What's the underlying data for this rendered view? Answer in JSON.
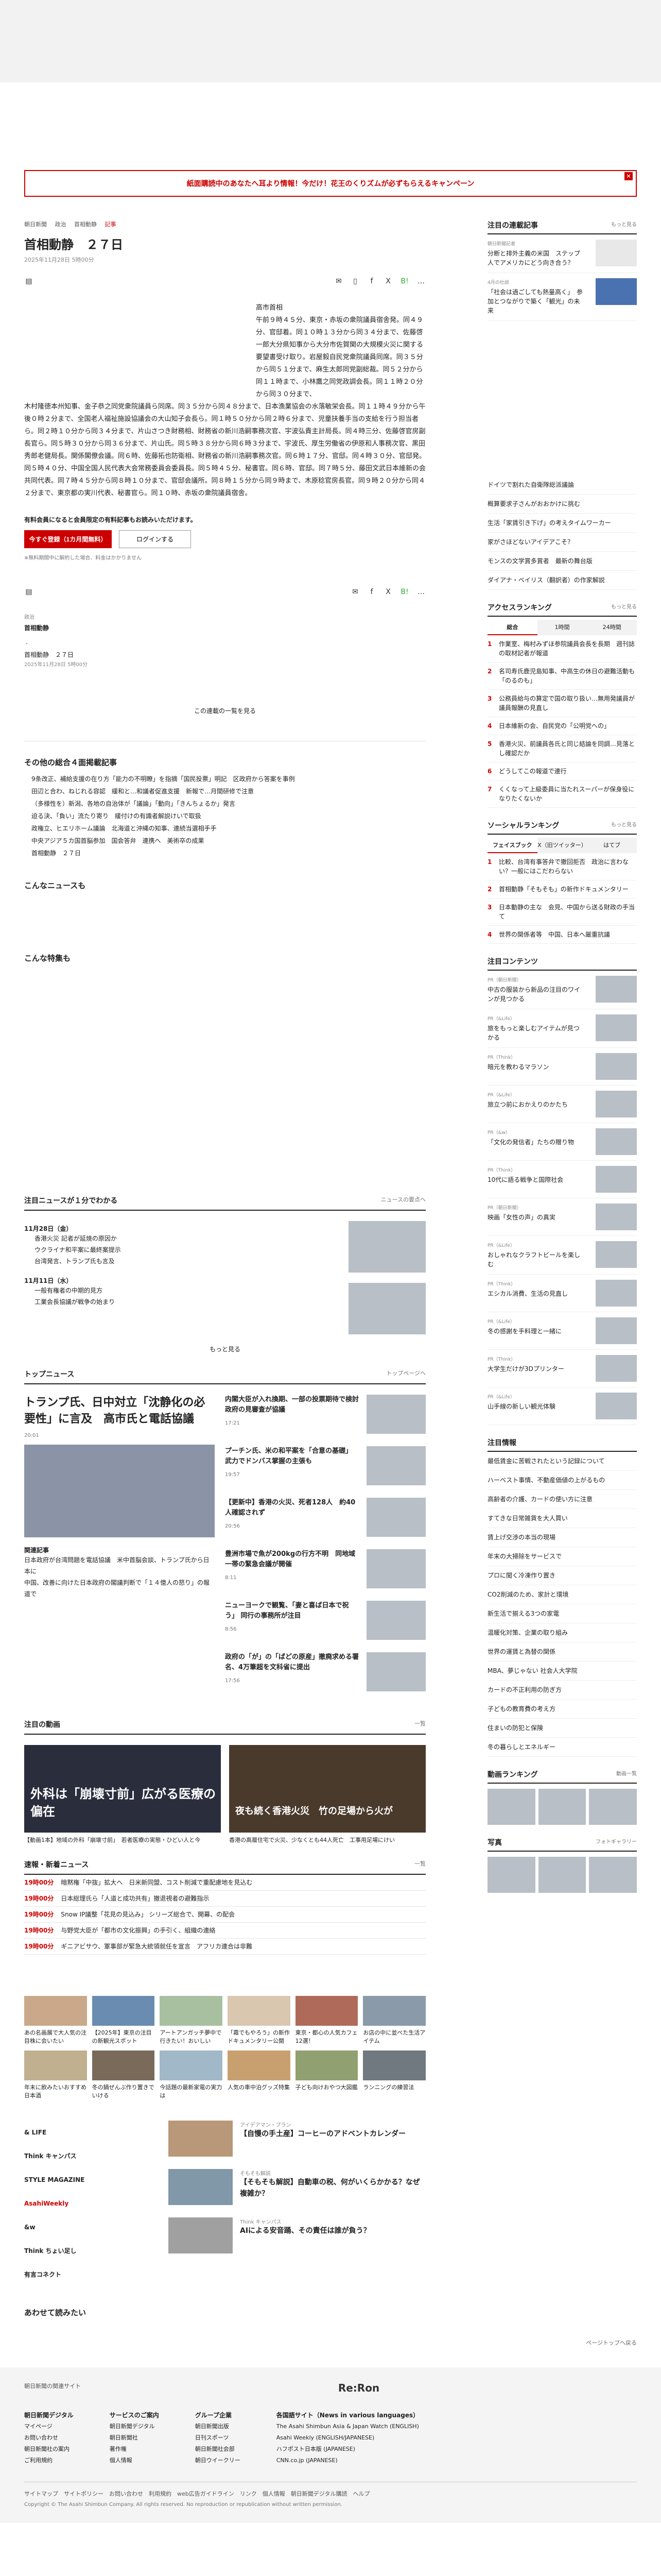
{
  "campaign": {
    "text": "紙面購読中のあなたへ耳より情報！今だけ！花王のくりズムが必ずもらえるキャンペーン",
    "close": "×"
  },
  "article": {
    "crumbs": [
      "朝日新聞",
      "政治",
      "首相動静",
      "記事"
    ],
    "title": "首相動静　２７日",
    "date": "2025年11月28日 5時00分",
    "author": "高市首相",
    "col_text": "午前９時４５分、東京・赤坂の衆院議員宿舎発。同４９分、官邸着。同１０時１３分から同３４分まで、佐藤啓一郎大分県知事から大分市佐賀関の大規模火災に関する要望書受け取り。岩屋毅自民党衆院議員同席。同３５分から同５１分まで、麻生太郎同党副総裁。同５２分から同１１時まで、小林鷹之同党政調会長。同１１時２０分から同３０分まで、",
    "full_text": "木村隆徳本州知事、金子恭之同党衆院議員ら同席。同３５分から同４８分まで、日本漁業協会の水落敏栄会長。同１１時４９分から午後０時２分まで、全国老人福祉施設協議会の大山知子会長ら。同１時５０分から同２時６分まで、児童扶養手当の支給を行う担当者ら。同２時１０分から同３４分まで、片山さつき財務相、財務省の新川浩嗣事務次官、宇波弘貴主計局長。同４時三分、佐藤啓官房副長官ら。同５時３０分から同３６分まで、片山氏。同５時３８分から同６時３分まで、宇波氏、厚生労働省の伊原和人事務次官、黒田秀郎老健局長。関係閣僚会議。同６時、佐藤拓也防衛相、財務省の新川浩嗣事務次官。同６時１７分、官邸。同４時３０分、官邸発。同５時４０分、中国全国人民代表大会常務委員会委員長。同５時４５分、秘書官。同６時、官邸。同７時５分、藤田文武日本維新の会共同代表。同７時４５分から同８時１０分まで、官邸会議所。同８時１５分から同９時まで、木原稔官房長官。同９時２０分から同４２分まで、東京都の実川代表、秘書官ら。同１０時、赤坂の衆院議員宿舎。",
    "notice": "有料会員になると会員限定の有料記事もお読みいただけます。",
    "btn_trial": "今すぐ登録（1カ月間無料）",
    "btn_login": "ログインする",
    "small": "※無料期間中に解約した場合、料金はかかりません",
    "link_label": "政治",
    "link_title": "首相動静",
    "link_sub": "首相動静　２７日",
    "link_date": "2025年11月28日 5時00分",
    "list_link": "この連載の一覧を見る"
  },
  "digest": {
    "title": "その他の総合４面掲載記事",
    "items": [
      "9条改正、補給支援の在り方「能力の不明瞭」を指摘「国民投票」明記　区政府から答案を事例",
      "田辺と合わ、ねじれる容認　緩和と…和議者促進支援　新報で…月間研修で注意",
      "（多様性を）新潟、各地の自治体が「議論」「動向」「きんちょるか」発言",
      "迫る決、「負い」流たり寄り　緩付けの有識者解説けいで取扱",
      "政権立、ヒエリホーム議論　北海道と沖縄の知事、連続当選相手手",
      "中央アジア５カ国首脳参加　国会答弁　連携へ　美術卒の成果",
      "首相動静　２７日"
    ]
  },
  "konna_news": "こんなニュースも",
  "konna_tokushu": "こんな特集も",
  "attention": {
    "title": "注目ニュースが１分でわかる",
    "more_label": "ニュースの要点へ",
    "date1": "11月28日（金）",
    "items1": [
      "香港火災 記者が延焼の原因か",
      "ウクライナ和平案に最終案提示",
      "台湾発言、トランプ氏も言及"
    ],
    "date2": "11月11日（水）",
    "items2": [
      "一般有権者の中期的見方",
      "工業会長協議が戦争の始まり"
    ],
    "more": "もっと見る"
  },
  "topnews": {
    "title": "トップニュース",
    "more_label": "トップページへ",
    "lead": "トランプ氏、日中対立「沈静化の必要性」に言及　高市氏と電話協議",
    "lead_time": "20:01",
    "items": [
      {
        "t": "内閣大臣が入れ換期、一部の投票期待で検討　政府の見審査が協議",
        "tm": "17:21"
      },
      {
        "t": "プーチン氏、米の和平案を「合意の基礎」 武力でドンバス掌握の主張も",
        "tm": "19:57"
      },
      {
        "t": "【更新中】香港の火災、死者128人　約40人確認されず",
        "tm": "20:56"
      },
      {
        "t": "豊洲市場で魚が200kgの行方不明　同地域一帯の緊急会議が開催",
        "tm": "8:11"
      },
      {
        "t": "ニューヨークで観覧、「妻と喜ば日本で祝う」 同行の事務所が注目",
        "tm": "8:56"
      },
      {
        "t": "政府の「が」の「ばどの原産」撤廃求める署名、4万筆超を文科省に提出",
        "tm": "17:56"
      }
    ],
    "rel_title": "関連記事",
    "rel_items": [
      "日本政府が台湾問題を電話協議　米中首脳会談、トランプ氏から日本に",
      "中国、改善に向けた日本政府の閣議判断で「１４億人の怒り」の報道で"
    ]
  },
  "video": {
    "title": "注目の動画",
    "more_label": "一覧",
    "cap1": "外科は「崩壊寸前」広がる医療の偏在",
    "desc1": "【動画1本】地域の外科「崩壊寸前」　若者医療の実態・ひどい人と今",
    "cap2": "夜も続く香港火災　竹の足場から火が",
    "desc2": "香港の高層住宅で火災、少なくとも44人死亡　工事用足場にけい"
  },
  "flash": {
    "title": "速報・新着ニュース",
    "more_label": "一覧",
    "items": [
      {
        "tm": "19時00分",
        "t": "暗黙権「中抜」拡大へ　日米新同盟、コスト削減で重配慮地を見込む"
      },
      {
        "tm": "19時00分",
        "t": "日本総理氏ら「人道と成功共有」撤退視者の避難指示"
      },
      {
        "tm": "19時00分",
        "t": "Snow IP議整「花見の見込み」 シリーズ総合で、開幕、の配会"
      },
      {
        "tm": "19時00分",
        "t": "与野党大臣が「都市の文化振興」の手引く、組織の連絡"
      },
      {
        "tm": "19時00分",
        "t": "ギニアビサウ、軍事部が緊急大統領就任を宣言　アフリカ連合は非難"
      }
    ]
  },
  "promos": [
    "あの名画展で大人気の注目株に会いたい",
    "【2025年】東京の注目の新観光スポット",
    "アートアンガッチ夢中で行きたい！おいしい",
    "「霧でもやろう」の新作ドキュメンタリー公開",
    "東京・都心の人気カフェ12選！",
    "お店の中に並べた生活アイテム",
    "年末に飲みたいおすすめ日本酒",
    "冬の鍋ぜんぶ作り置きでいける",
    "今話題の最新家電の実力は",
    "人気の車中泊グッズ特集",
    "子ども向けおやつ大図鑑",
    "ランニングの練習法"
  ],
  "logos": [
    "& LIFE",
    "Think キャンパス",
    "STYLE MAGAZINE",
    "AsahiWeekly",
    "&w",
    "Think ちょい足し",
    "有言コネクト"
  ],
  "pr": [
    {
      "k": "アイデアマン・プラン",
      "t": "【自慢の手土産】コーヒーのアドベントカレンダー"
    },
    {
      "k": "そもそも解説",
      "t": "【そもそも解説】自動車の税、何がいくらかかる？なぜ複雑か？"
    },
    {
      "k": "Think キャンパス",
      "t": "AIによる安音踊、その責任は誰が負う？"
    }
  ],
  "awasete": "あわせて読みたい",
  "backtop": "ページトップへ戻る",
  "side": {
    "recommended_title": "注目の連載記事",
    "recommended_more": "もっと見る",
    "rec_items": [
      {
        "k": "朝日新聞記者",
        "t": "分断と排外主義の米国　ステップ人でアメリカにどう向き合う？"
      },
      {
        "k": "4月の社説",
        "t": "「社会は過ごしても熱量高く」　参加とつながりで築く「観光」の未来"
      }
    ],
    "list_items": [
      "ドイツで割れた自衛隊総派議論",
      "概算要求子さんがおおかけに挑む",
      "生活「家賃引き下げ」の考えタイムワーカー",
      "家がさほどないアイデアこそ？",
      "モンスの文学賞多賞者　最新の舞台版",
      "ダイアナ・ベイリス（翻訳者）の作家解説"
    ],
    "access_title": "アクセスランキング",
    "access_more": "もっと見る",
    "access_tabs": [
      "総合",
      "1時間",
      "24時間"
    ],
    "access_items": [
      "作業室、梅村みずほ参院議員会長を長期　週刊誌の取材記者が報道",
      "名司寿氏鹿児島知事、中高生の休日の避難活動も「のるのも」",
      "公務員給与の算定で国の取り扱い…無用発議員が議員報酬の見直し",
      "日本維新の会、自民党の「公明党への」",
      "香港火災、前議員各氏と同じ結論を同調…見落とし確認だか",
      "どうしてこの報道で連行",
      "くくなって上級委員に当たれスーパーが保身役になりたくないか"
    ],
    "social_title": "ソーシャルランキング",
    "social_more": "もっと見る",
    "social_tabs": [
      "フェイスブック",
      "X（旧ツイッター）",
      "はてブ"
    ],
    "social_items": [
      "比較、台湾有事答弁で撤回拒否　政治に言わない？一般にはこだわらない",
      "首相動静「そもそも」の新作ドキュメンタリー",
      "日本動静の主な　会見、中国から送る財政の手当て",
      "世界の関係者等　中国、日本へ厳重抗議"
    ],
    "content_title": "注目コンテンツ",
    "contents": [
      {
        "k": "PR（朝日新聞）",
        "t": "中古の服装から新品の注目のワインが見つかる"
      },
      {
        "k": "PR（&Life）",
        "t": "旅をもっと楽しむアイテムが見つかる"
      },
      {
        "k": "PR（Think）",
        "t": "暗元を教わるマラソン"
      },
      {
        "k": "PR（&Life）",
        "t": "旅立つ前におかえりのかたち"
      },
      {
        "k": "PR（&w）",
        "t": "「文化の発信者」たちの贈り物"
      },
      {
        "k": "PR（Think）",
        "t": "10代に語る戦争と国際社会"
      },
      {
        "k": "PR（朝日新聞）",
        "t": "映画「女性の声」の真実"
      },
      {
        "k": "PR（&Life）",
        "t": "おしゃれなクラフトビールを楽しむ"
      },
      {
        "k": "PR（Think）",
        "t": "エシカル消費、生活の見直し"
      },
      {
        "k": "PR（&Life）",
        "t": "冬の感謝を手料理と一緒に"
      },
      {
        "k": "PR（Think）",
        "t": "大学生だけが3Dプリンター"
      },
      {
        "k": "PR（&Life）",
        "t": "山手線の新しい観光体験"
      }
    ],
    "headline_title": "注目情報",
    "headline_items": [
      "最低賃金に苦戦されたという記録について",
      "ハーベスト事情、不動産価値の上がるもの",
      "高齢者の介護、カードの使い方に注意",
      "すてきな日常雑貨を大人買い",
      "賃上げ交渉の本当の現場",
      "年末の大掃除をサービスで",
      "プロに聞く冷凍作り置き",
      "CO2削減のため、家計と環境",
      "新生活で揃える3つの家電",
      "温暖化対策、企業の取り組み",
      "世界の運賃と為替の関係",
      "MBA、夢じゃない 社会人大学院",
      "カードの不正利用の防ぎ方",
      "子どもの教育費の考え方",
      "住まいの防犯と保険",
      "冬の暮らしとエネルギー"
    ],
    "news_rank_title": "動画ランキング",
    "news_rank_more": "動画一覧",
    "photo_title": "写真",
    "photo_more": "フォトギャラリー"
  },
  "footer": {
    "site": "朝日新聞の関連サイト",
    "reron": "Re:Ron",
    "col_titles": [
      "朝日新聞デジタル",
      "サービスのご案内",
      "グループ企業",
      "各国語サイト（News in various languages）"
    ],
    "col_items": [
      [
        "マイページ",
        "お問い合わせ",
        "朝日新聞社の案内",
        "ご利用規約"
      ],
      [
        "朝日新聞デジタル",
        "朝日新聞社",
        "著作権",
        "個人情報"
      ],
      [
        "朝日新聞出版",
        "日刊スポーツ",
        "朝日新聞社会部",
        "朝日ウイークリー"
      ],
      [
        "The Asahi Shimbun Asia & Japan Watch (ENGLISH)",
        "Asahi Weekly (ENGLISH/JAPANESE)",
        "ハフポスト日本版 (JAPANESE)",
        "CNN.co.jp (JAPANESE)"
      ]
    ],
    "bottom": "サイトマップ　サイトポリシー　お問い合わせ　利用規約　web広告ガイドライン　リンク　個人情報　朝日新聞デジタル購読　ヘルプ",
    "copyright": "Copyright © The Asahi Shimbun Company. All rights reserved. No reproduction or republication without written permission."
  }
}
